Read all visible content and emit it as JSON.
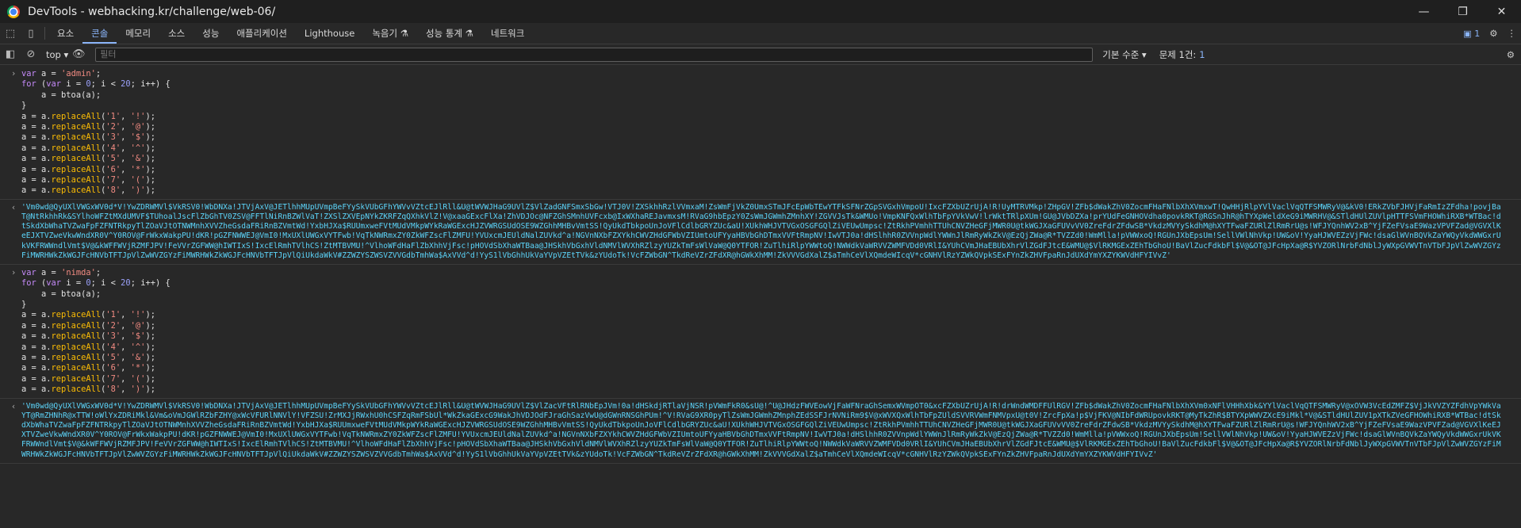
{
  "window": {
    "title": "DevTools - webhacking.kr/challenge/web-06/",
    "minimize": "—",
    "maximize": "❐",
    "close": "✕"
  },
  "tabs": [
    "요소",
    "콘솔",
    "메모리",
    "소스",
    "성능",
    "애플리케이션",
    "Lighthouse",
    "녹음기 ⚗",
    "성능 통계 ⚗",
    "네트워크"
  ],
  "active_tab": "콘솔",
  "toolbar_right": {
    "issues_badge": "1"
  },
  "filterbar": {
    "context": "top",
    "filter_placeholder": "필터",
    "levels": "기본 수준 ▾",
    "issues_label": "문제 1건:",
    "issues_count": "1"
  },
  "console": {
    "block1": {
      "assign_var": "var",
      "assign_name": " a = ",
      "assign_value": "'admin'",
      "assign_end": ";",
      "for_kw": "for",
      "for_open": " (",
      "for_var": "var",
      "for_rest1": " i = ",
      "for_n0": "0",
      "for_rest2": "; i < ",
      "for_n20": "20",
      "for_rest3": "; i++) {",
      "body": "    a = btoa(a);",
      "close": "}",
      "replaces": [
        {
          "from": "'1'",
          "to": "'!'"
        },
        {
          "from": "'2'",
          "to": "'@'"
        },
        {
          "from": "'3'",
          "to": "'$'"
        },
        {
          "from": "'4'",
          "to": "'^'"
        },
        {
          "from": "'5'",
          "to": "'&'"
        },
        {
          "from": "'6'",
          "to": "'*'"
        },
        {
          "from": "'7'",
          "to": "'('"
        },
        {
          "from": "'8'",
          "to": "')'"
        }
      ],
      "result": "'Vm0wd@QyUXlVWGxWV0d*V!YwZDRWMVl$VkRSV0!WbDNXa!JTVjAxV@JETlhhMUpUVmpBeFYySkVUbGFhYWVvVZtcEJlRll&U@tWVWJHaG9UVlZ$VlZadGNFSmxSbGw!VTJ0V!ZXSkhhRzlVVmxaM!ZsWmFjVkZ0UmxSTmJFcEpWbTEwYTFkSFNrZGpSVGxhVmpoU!IxcFZXbUZrUjA!R!UyMTRVMkp!ZHpGV!ZFb$dWakZhV0ZocmFHaFNlbXhXVmxwT!QwHHjRlpYVlVaclVqQTFSMWRyV@&kV0!ERkZVbFJHVjFaRmIzZFdha!povjBaT@NtRkhhRk&SYlhoWFZtMXdUMVF$TUhoalJscFlZbGhTV0ZSV@FFTlNiRnBZWlVaT!ZXSlZXVEpNYkZKRFZqQXhkVlZ!V@xaaGExcFlXa!ZhVDJOc@NFZGhSMnhUVFcxb@IxWXhaREJavmxsM!RVaG9hbEpzY0ZsWmJGWmhZMnhXY!ZGVVJsTk&WMUo!VmpKNFQxWlhTbFpYVkVwV!lrWktTRlpXUm!GU@JVbDZXa!prYUdFeGNHOVdha0povkRKT@RGSnJhR@hTYXpWeldXeG9iMWRHV@&STldHUlZUVlpHTTFSVmFHOWhiRXB*WTBac!dtSkdXbWhaTVZwaFpFZFNTRkpyTlZOaVJtOTNWMnhXVVZheGsdaFRiRnBZVmtWd!YxbHJXa$RUUmxweFVtMUdVMkpWYkRaWGExcHJZVWRGSUdOSE9WZGhhMHBvVmtSS!QyUkdTbkpoUnJoVFlCdlbGRYZUc&aU!XUkhWHJVTVGxOSGFGQlZiVEUwUmpsc!ZtRkhPVmhhTTUhCNVZHeGFjMWR0U@tkWGJXaGFUVvVV0ZreFdrZFdwSB*VkdzMVYySkdhM@hXYTFwaFZURlZlRmRrU@s!WFJYQnhWV2xB^YjFZeFVsaE9WazVPVFZad@VGVXlKeEJXTVZweVkwWndXR0V^Y0ROV@FrWkxWakpPU!dKR!pGZFNWWEJ@VmI0!MxUXlUWGxVYTFwb!VqTkNWRmxZY0ZkWFZscFlZMFU!YVUxcmJEUldNalZUVkd^a!NGVnNXbFZXYkhCWVZHdGFWbVZIUmtoUFYyaHBVbGhDTmxVVFtRmpNV!IwVTJ0a!dHSlhhR0ZVVnpWdlYWWnJlRmRyWkZkV@EzQjZWa@R*TVZZd0!WmMlla!pVWWxoQ!RGUnJXbEpsUm!SellVWlNhVkp!UW&oV!YyaHJWVEZzVjFWc!dsaGlWVnBQVkZaYWQyVkdWWGxrUkVKFRWWndlVmt$V@&kWFFWVjRZMFJPV!FeVVrZGFWW@hIWTIxS!IxcElRmhTVlhCS!ZtMTBVMU!^VlhoWFdHaFlZbXhhVjFsc!pHOVdSbXhaWTBaa@JHSkhVbGxhVldNMVlWVXhRZlzyYUZkTmFsWlVaW@Q0YTFOR!ZuTlhiRlpYWWtoQ!NWWdkVaWRVVZWMFVDd0VRlI&YUhCVmJHaEBUbXhrVlZGdFJtcE&WMU@$VlRKMGExZEhTbGhoU!BaVlZucFdkbFl$V@&OT@JFcHpXa@R$YVZORlNrbFdNblJyWXpGVWVTnVTbFJpVlZwWVZGYzFiMWRHWkZkWGJFcHNVbTFTJpVlZwWVZGYzFiMWRHWkZkWGJFcHNVbTFTJpVlQiUkdaWkV#ZZWZYSZWSVZVVGdbTmhWa$AxVVd^d!YyS1lVbGhhUkVaYVpVZEtTVk&zYUdoTk!VcFZWbGN^TkdReVZrZFdXR@hGWkXhMM!ZkVVVGdXalZ$aTmhCeVlXQmdeWIcqV*cGNHVlRzYZWkQVpkSExFYnZkZHVFpaRnJdUXdYmYXZYKWVdHFYIVvZ'"
    },
    "block2": {
      "assign_var": "var",
      "assign_name": " a = ",
      "assign_value": "'nimda'",
      "assign_end": ";",
      "for_kw": "for",
      "for_open": " (",
      "for_var": "var",
      "for_rest1": " i = ",
      "for_n0": "0",
      "for_rest2": "; i < ",
      "for_n20": "20",
      "for_rest3": "; i++) {",
      "body": "    a = btoa(a);",
      "close": "}",
      "replaces": [
        {
          "from": "'1'",
          "to": "'!'"
        },
        {
          "from": "'2'",
          "to": "'@'"
        },
        {
          "from": "'3'",
          "to": "'$'"
        },
        {
          "from": "'4'",
          "to": "'^'"
        },
        {
          "from": "'5'",
          "to": "'&'"
        },
        {
          "from": "'6'",
          "to": "'*'"
        },
        {
          "from": "'7'",
          "to": "'('"
        },
        {
          "from": "'8'",
          "to": "')'"
        }
      ],
      "result": "'Vm0wd@QyUXlVWGxWV0d*V!YwZDRWMVl$VkRSV0!WbDNXa!JTVjAxV@JETlhhMUpUVmpBeFYySkVUbGFhYWVvVZtcEJlRll&U@tWVWJHaG9UVlZ$VlZacVFtRlRNbEpJVm!0a!dHSkdjRTlaVjNSR!pVWmFkR0&sU@!^U@JHdzFWVEowVjFaWFNraGhSemxWVmpOT0&xcFZXbUZrUjA!R!drWndWMDFFUlRGV!ZFb$dWakZhV0ZocmFHaFNlbXhXVm0xNFlVHHhXbk&YYlVaclVqQTFSMWRyV@xOVW3VcEdZMFZ$VjJkVVZYZFdhVpYWkVaYT@RmZHNhR@xTTW!oWlYxZDRiMkl&Vm&oVmJGWlRZbFZHY@xWcVFURlNNVlY!VFZSU!ZrMXJjRWxhU0hCSFZqRmFSbUl*WkZkaGExcG9WakJhVDJOdFJraGhSazVwU@dGWnRNSGhPUm!^V!RVaG9XR0pyTlZsWmJGWmhZMnphZEdSSFJrNVNiRm9$V@xWVXQxWlhTbFpZUldSVVRVWmFNMVpxU@t0V!ZrcFpXa!p$VjFKV@NIbFdWRUpovkRKT@MyTkZhR$BTYXpWWVZXcE9iMkl*V@&STldHUlZUV1pXTkZVeGFHOWhiRXB*WTBac!dtSkdXbWhaTVZwaFpFZFNTRkpyTlZOaVJtOTNWMnhXVVZheGsdaFRiRnBZVmtWd!YxbHJXa$RUUmxweFVtMUdVMkpWYkRaWGExcHJZVWRGSUdOSE9WZGhhMHBvVmtSS!QyUkdTbkpoUnJoVFlCdlbGRYZUc&aU!XUkhWHJVTVGxOSGFGQlZiVEUwUmpsc!ZtRkhPVmhhTTUhCNVZHeGFjMWR0U@tkWGJXaGFUVvVV0ZreFdrZFdwSB*VkdzMVYySkdhM@hXYTFwaFZURlZlRmRrU@s!WFJYQnhWV2xB^YjFZeFVsaE9WazVPVFZad@VGVXlKeEJXTVZweVkwWndXR0V^Y0ROV@FrWkxWakpPU!dKR!pGZFNWWEJ@VmI0!MxUXlUWGxVYTFwb!VqTkNWRmxZY0ZkWFZscFlZMFU!YVUxcmJEUldNalZUVkd^a!NGVnNXbFZXYkhCWVZHdGFWbVZIUmtoUFYyaHBVbGhDTmxVVFtRmpNV!IwVTJ0a!dHSlhhR0ZVVnpWdlYWWnJlRmRyWkZkV@EzQjZWa@R*TVZZd0!WmMlla!pVWWxoQ!RGUnJXbEpsUm!SellVWlNhVkp!UW&oV!YyaHJWVEZzVjFWc!dsaGlWVnBQVkZaYWQyVkdWWGxrUkVKFRWWndlVmt$V@&kWFFWVjRZMFJPV!FeVVrZGFWW@hIWTIxS!IxcElRmhTVlhCS!ZtMTBVMU!^VlhoWFdHaFlZbXhhVjFsc!pHOVdSbXhaWTBaa@JHSkhVbGxhVldNMVlWVXhRZlzyYUZkTmFsWlVaW@Q0YTFOR!ZuTlhiRlpYWWtoQ!NWWdkVaWRVVZWMFVDd0VRlI&YUhCVmJHaEBUbXhrVlZGdFJtcE&WMU@$VlRKMGExZEhTbGhoU!BaVlZucFdkbFl$V@&OT@JFcHpXa@R$YVZORlNrbFdNblJyWXpGVWVTnVTbFJpVlZwWVZGYzFiMWRHWkZkWGJFcHNVbTFTJpVlZwWVZGYzFiMWRHWkZkWGJFcHNVbTFTJpVlQiUkdaWkV#ZZWZYSZWSVZVVGdbTmhWa$AxVVd^d!YyS1lVbGhhUkVaYVpVZEtTVk&zYUdoTk!VcFZWbGN^TkdReVZrZFdXR@hGWkXhMM!ZkVVVGdXalZ$aTmhCeVlXQmdeWIcqV*cGNHVlRzYZWkQVpkSExFYnZkZHVFpaRnJdUXdYmYXZYKWVdHFYIVvZ'"
    }
  }
}
